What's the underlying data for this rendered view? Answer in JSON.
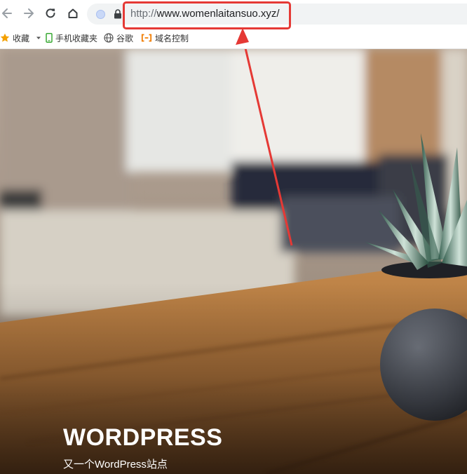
{
  "browser": {
    "url_scheme": "http://",
    "url_host": "www.womenlaitansuo.xyz/",
    "icons": [
      "back-icon",
      "forward-icon",
      "reload-icon",
      "home-icon",
      "site-info-icon",
      "lock-icon"
    ]
  },
  "bookmarks": {
    "items": [
      {
        "label": "收藏",
        "icon": "star-icon"
      },
      {
        "label": "手机收藏夹",
        "icon": "phone-icon"
      },
      {
        "label": "谷歌",
        "icon": "globe-icon"
      },
      {
        "label": "域名控制",
        "icon": "bracket-icon"
      }
    ]
  },
  "site": {
    "title": "WORDPRESS",
    "tagline": "又一个WordPress站点"
  },
  "colors": {
    "annotation": "#e53935",
    "omnibox": "#f1f3f4",
    "star": "#f4a000",
    "phone": "#3aaa35",
    "domain": "#f07c00"
  }
}
